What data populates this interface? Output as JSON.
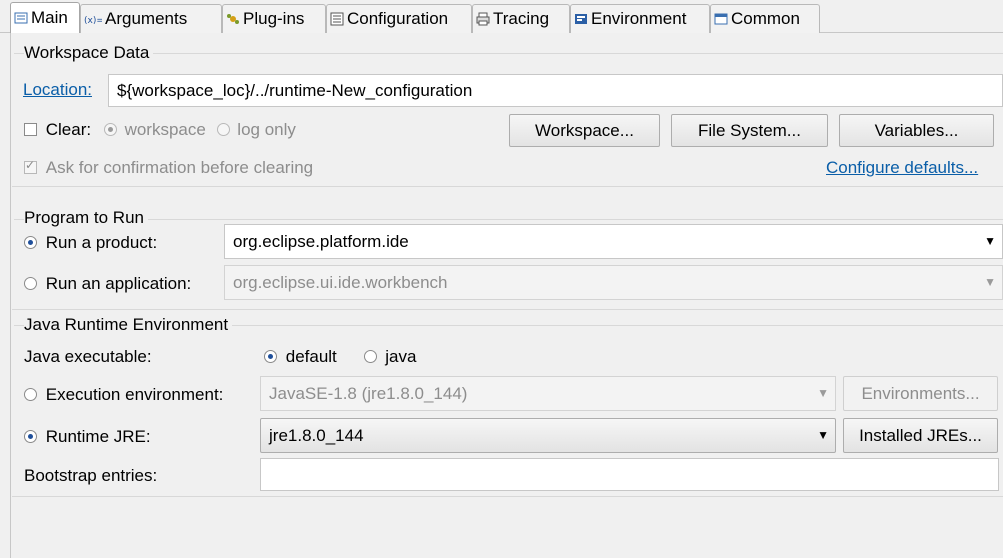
{
  "tabs": [
    {
      "label": "Main",
      "icon": "main-tab-icon"
    },
    {
      "label": "Arguments",
      "icon": "arguments-tab-icon"
    },
    {
      "label": "Plug-ins",
      "icon": "plugins-tab-icon"
    },
    {
      "label": "Configuration",
      "icon": "configuration-tab-icon"
    },
    {
      "label": "Tracing",
      "icon": "tracing-tab-icon"
    },
    {
      "label": "Environment",
      "icon": "environment-tab-icon"
    },
    {
      "label": "Common",
      "icon": "common-tab-icon"
    }
  ],
  "workspace": {
    "title": "Workspace Data",
    "location_label": "Location:",
    "location_value": "${workspace_loc}/../runtime-New_configuration",
    "clear_label": "Clear:",
    "clear_opt_workspace": "workspace",
    "clear_opt_log": "log only",
    "btn_workspace": "Workspace...",
    "btn_filesystem": "File System...",
    "btn_variables": "Variables...",
    "confirm_label": "Ask for confirmation before clearing",
    "configure_defaults": "Configure defaults..."
  },
  "program": {
    "title": "Program to Run",
    "run_product_label": "Run a product:",
    "run_product_value": "org.eclipse.platform.ide",
    "run_app_label": "Run an application:",
    "run_app_value": "org.eclipse.ui.ide.workbench"
  },
  "jre": {
    "title": "Java Runtime Environment",
    "java_exec_label": "Java executable:",
    "opt_default": "default",
    "opt_java": "java",
    "exec_env_label": "Execution environment:",
    "exec_env_value": "JavaSE-1.8 (jre1.8.0_144)",
    "btn_environments": "Environments...",
    "runtime_jre_label": "Runtime JRE:",
    "runtime_jre_value": "jre1.8.0_144",
    "btn_installed_jres": "Installed JREs...",
    "bootstrap_label": "Bootstrap entries:",
    "bootstrap_value": ""
  },
  "colors": {
    "link": "#0a5ea8",
    "radio_selected": "#1f4f9a"
  }
}
